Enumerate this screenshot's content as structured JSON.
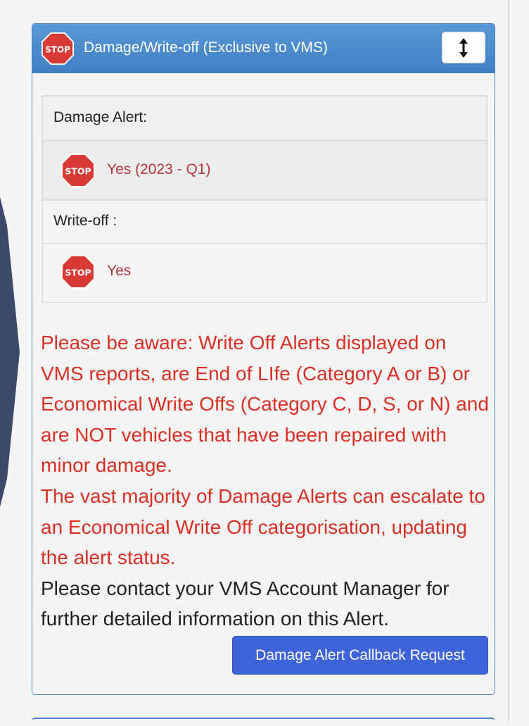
{
  "panel": {
    "title": "Damage/Write-off (Exclusive to VMS)",
    "stop_text": "STOP",
    "toggle_icon": "vertical-resize-icon"
  },
  "rows": {
    "damage_label": "Damage Alert:",
    "damage_value": "Yes (2023 - Q1)",
    "writeoff_label": "Write-off :",
    "writeoff_value": "Yes"
  },
  "notice": {
    "para1": "Please be aware: Write Off Alerts displayed on VMS reports, are End of LIfe (Category A or B) or Economical Write Offs (Category C, D, S, or N) and are NOT vehicles that have been repaired with minor damage.",
    "para2": "The vast majority of Damage Alerts can escalate to an Economical Write Off categorisation, updating the alert status.",
    "para3": "Please contact your VMS Account Manager for further detailed information on this Alert."
  },
  "callback_button": "Damage Alert Callback Request",
  "colors": {
    "header_blue": "#3f7fc3",
    "alert_red": "#dc2f24",
    "value_red": "#b5363f",
    "button_blue": "#3f63d8"
  }
}
